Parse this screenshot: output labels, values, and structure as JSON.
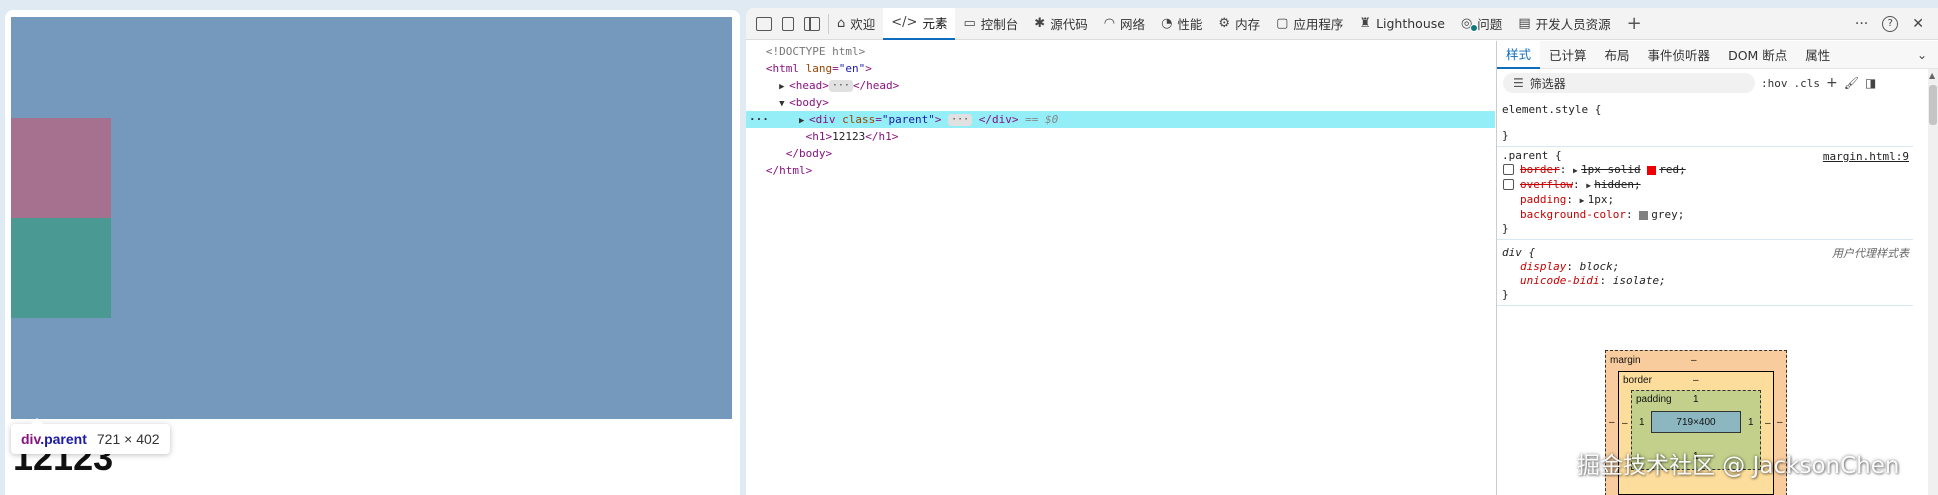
{
  "preview": {
    "heading": "12123",
    "tooltip": {
      "tag": "div",
      "cls": ".parent",
      "dims": "721 × 402"
    },
    "colors": {
      "parent_highlight": "#7599bd",
      "child_pink": "#a6718f",
      "child_teal": "#4a9a93"
    }
  },
  "toolbar": {
    "tabs": [
      {
        "icon": "home-icon",
        "label": "欢迎"
      },
      {
        "icon": "code-icon",
        "label": "元素",
        "active": true
      },
      {
        "icon": "console-icon",
        "label": "控制台"
      },
      {
        "icon": "bug-icon",
        "label": "源代码"
      },
      {
        "icon": "wifi-icon",
        "label": "网络"
      },
      {
        "icon": "gauge-icon",
        "label": "性能"
      },
      {
        "icon": "gear-icon",
        "label": "内存"
      },
      {
        "icon": "app-icon",
        "label": "应用程序"
      },
      {
        "icon": "lighthouse-icon",
        "label": "Lighthouse"
      },
      {
        "icon": "bulb-icon",
        "label": "问题"
      },
      {
        "icon": "doc-icon",
        "label": "开发人员资源"
      }
    ],
    "add_tab": "+",
    "more": "···",
    "help": "?",
    "close": "✕"
  },
  "dom": {
    "doctype": "<!DOCTYPE html>",
    "html_open": "<html",
    "lang_attr": "lang",
    "lang_val": "\"en\"",
    "head_open": "<head>",
    "head_close": "</head>",
    "body_open": "<body>",
    "div_open": "<div",
    "class_attr": "class",
    "class_val": "\"parent\"",
    "div_close": "</div>",
    "dollar": "== $0",
    "h1_open": "<h1>",
    "h1_text": "12123",
    "h1_close": "</h1>",
    "body_close": "</body>",
    "html_close": "</html>",
    "ellipsis": "···"
  },
  "styles": {
    "subtabs": [
      "样式",
      "已计算",
      "布局",
      "事件侦听器",
      "DOM 断点",
      "属性"
    ],
    "filter_placeholder": "筛选器",
    "hov": ":hov",
    "cls": ".cls",
    "element_style": "element.style {",
    "parent_selector": ".parent {",
    "parent_source": "margin.html:9",
    "decls": [
      {
        "name": "border",
        "value": "1px solid",
        "swatch": "#ee0000",
        "value2": "red;",
        "struck": true
      },
      {
        "name": "overflow",
        "value": "hidden;",
        "struck": true
      },
      {
        "name": "padding",
        "value": "1px;"
      },
      {
        "name": "background-color",
        "value": "grey;",
        "swatch": "#808080"
      }
    ],
    "ua_selector": "div {",
    "ua_source": "用户代理样式表",
    "ua_decls": [
      {
        "name": "display",
        "value": "block;"
      },
      {
        "name": "unicode-bidi",
        "value": "isolate;"
      }
    ],
    "close_brace": "}",
    "open_brace": "{"
  },
  "box_model": {
    "margin_label": "margin",
    "margin_top": "–",
    "margin_left": "–",
    "margin_right": "–",
    "border_label": "border",
    "border_top": "–",
    "border_left": "–",
    "border_right": "–",
    "padding_label": "padding",
    "padding_top": "1",
    "padding_left": "1",
    "padding_right": "1",
    "padding_bottom": "1",
    "content": "719×400"
  },
  "watermark": "掘金技术社区 @ JacksonChen"
}
